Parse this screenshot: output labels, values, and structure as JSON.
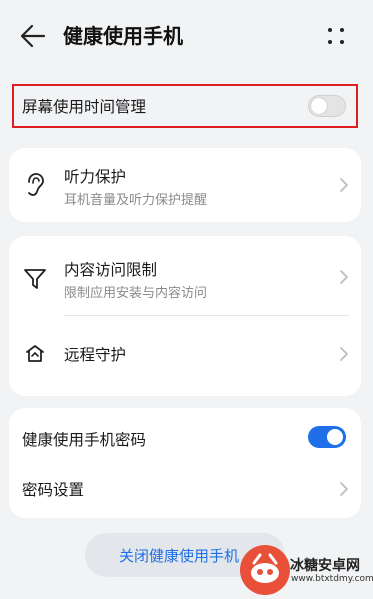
{
  "header": {
    "title": "健康使用手机"
  },
  "screen_time": {
    "label": "屏幕使用时间管理",
    "enabled": false
  },
  "hearing": {
    "title": "听力保护",
    "subtitle": "耳机音量及听力保护提醒"
  },
  "content": {
    "title": "内容访问限制",
    "subtitle": "限制应用安装与内容访问"
  },
  "remote": {
    "title": "远程守护"
  },
  "password": {
    "title": "健康使用手机密码",
    "enabled": true,
    "settings_label": "密码设置"
  },
  "bottom": {
    "button_label": "关闭健康使用手机"
  },
  "watermark": {
    "name": "冰糖安卓网",
    "url": "www.btxtdmy.com"
  },
  "colors": {
    "accent": "#1f6fe8",
    "highlight": "#e02020",
    "background": "#f1f3f5"
  }
}
